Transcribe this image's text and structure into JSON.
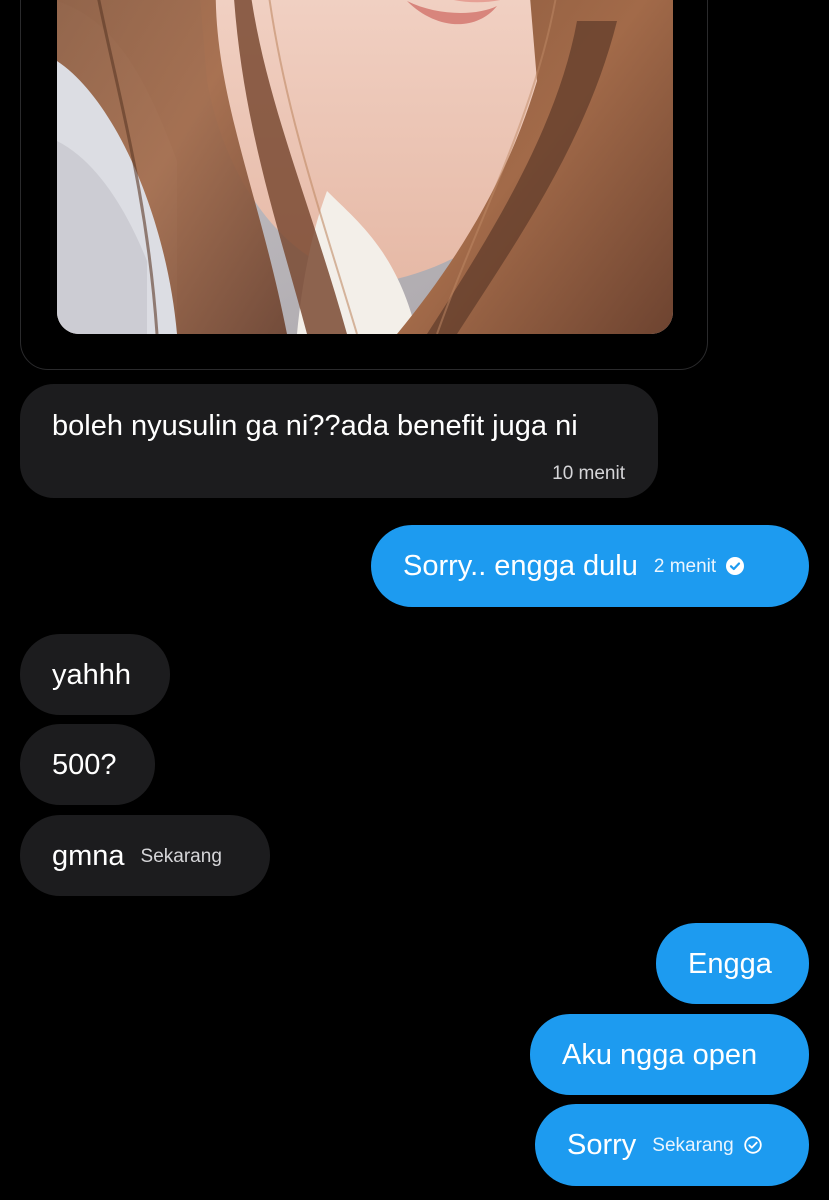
{
  "messages": [
    {
      "id": "b1",
      "direction": "incoming",
      "text": "boleh nyusulin ga ni??ada benefit juga ni",
      "time": "10 menit"
    },
    {
      "id": "b2",
      "direction": "outgoing",
      "text": "Sorry.. engga dulu",
      "time": "2 menit",
      "status": "read"
    },
    {
      "id": "b3",
      "direction": "incoming",
      "text": "yahhh"
    },
    {
      "id": "b4",
      "direction": "incoming",
      "text": "500?"
    },
    {
      "id": "b5",
      "direction": "incoming",
      "text": "gmna",
      "time": "Sekarang"
    },
    {
      "id": "b6",
      "direction": "outgoing",
      "text": "Engga"
    },
    {
      "id": "b7",
      "direction": "outgoing",
      "text": "Aku ngga open"
    },
    {
      "id": "b8",
      "direction": "outgoing",
      "text": "Sorry",
      "time": "Sekarang",
      "status": "sent"
    }
  ],
  "colors": {
    "background": "#000000",
    "incoming_bubble": "#1c1c1e",
    "outgoing_bubble": "#1d9bf0",
    "text": "#ffffff"
  },
  "icons": {
    "read_receipt": "check-circle-filled-icon",
    "sent_receipt": "check-circle-outline-icon"
  }
}
